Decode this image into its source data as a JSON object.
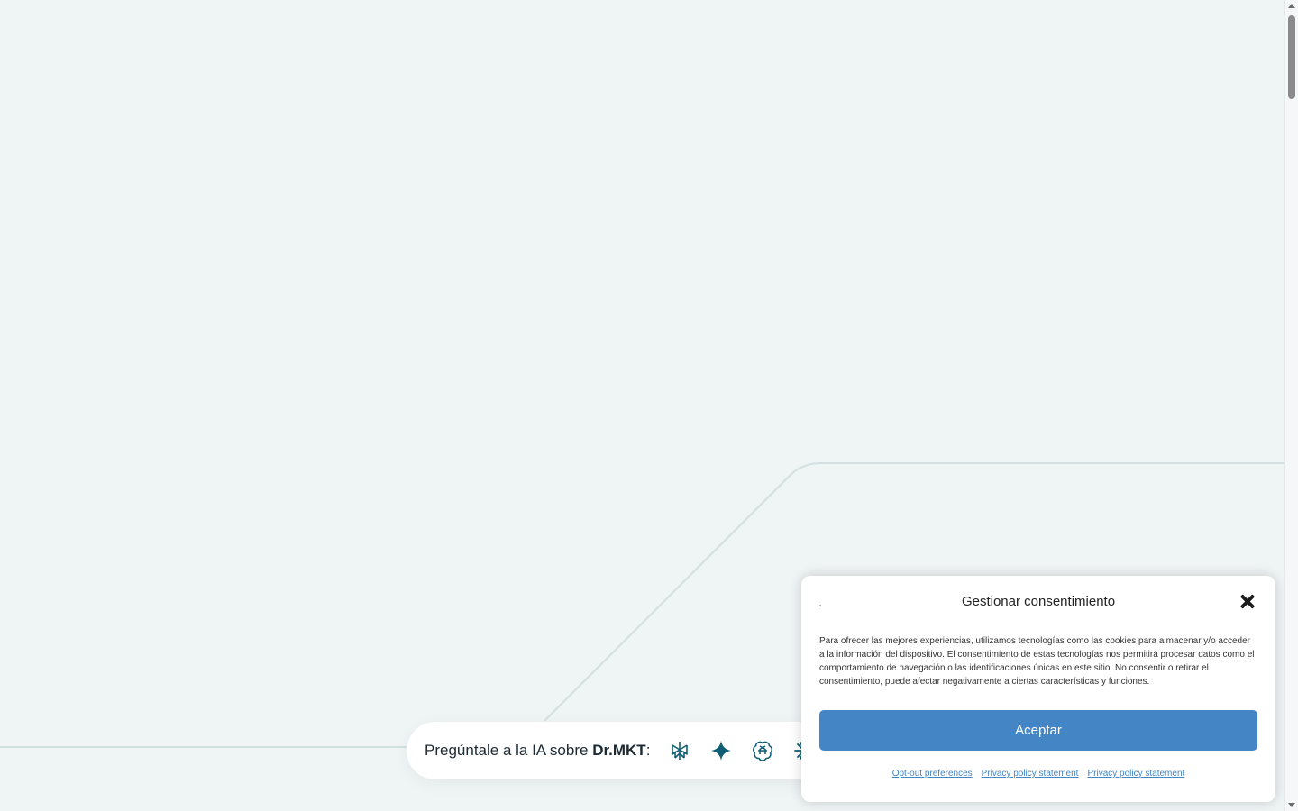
{
  "ai_bar": {
    "label_prefix": "Pregúntale a la IA sobre ",
    "label_brand": "Dr.MKT",
    "label_suffix": ":",
    "icons": [
      {
        "name": "perplexity-icon",
        "color": "#0e5f75"
      },
      {
        "name": "gemini-icon",
        "color": "#0e5f75"
      },
      {
        "name": "chatgpt-icon",
        "color": "#0e5f75"
      },
      {
        "name": "claude-icon",
        "color": "#0e5f75"
      },
      {
        "name": "grok-icon",
        "color": "#0e5f75"
      }
    ]
  },
  "consent": {
    "title": "Gestionar consentimiento",
    "body": "Para ofrecer las mejores experiencias, utilizamos tecnologías como las cookies para almacenar y/o acceder a la información del dispositivo. El consentimiento de estas tecnologías nos permitirá procesar datos como el comportamiento de navegación o las identificaciones únicas en este sitio. No consentir o retirar el consentimiento, puede afectar negativamente a ciertas características y funciones.",
    "accept_label": "Aceptar",
    "links": [
      "Opt-out preferences",
      "Privacy policy statement",
      "Privacy policy statement"
    ],
    "accent_color": "#4485c5"
  },
  "colors": {
    "background": "#eff4f5",
    "line": "#d3e0e2"
  }
}
